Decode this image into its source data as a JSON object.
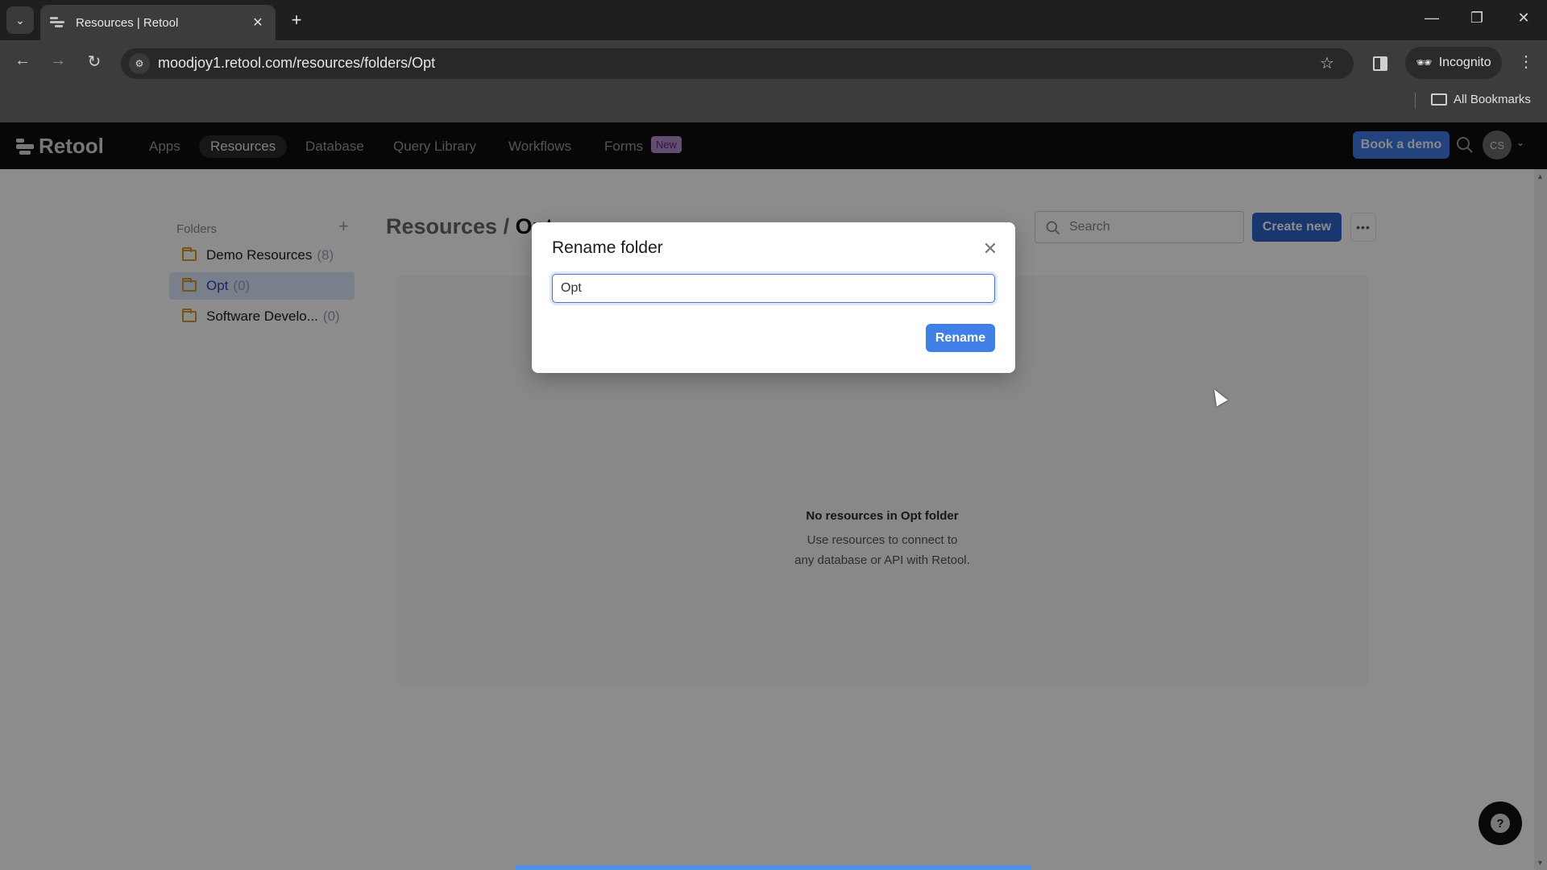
{
  "browser": {
    "tab_title": "Resources | Retool",
    "url": "moodjoy1.retool.com/resources/folders/Opt",
    "profile_label": "Incognito",
    "bookmarks_label": "All Bookmarks"
  },
  "nav": {
    "brand": "Retool",
    "links": [
      {
        "label": "Apps",
        "active": false
      },
      {
        "label": "Resources",
        "active": true
      },
      {
        "label": "Database",
        "active": false
      },
      {
        "label": "Query Library",
        "active": false
      },
      {
        "label": "Workflows",
        "active": false
      },
      {
        "label": "Forms",
        "active": false
      }
    ],
    "forms_badge": "New",
    "book_demo_label": "Book a demo",
    "avatar_initials": "CS"
  },
  "sidebar": {
    "title": "Folders",
    "folders": [
      {
        "name": "Demo Resources",
        "count": "(8)",
        "active": false
      },
      {
        "name": "Opt",
        "count": "(0)",
        "active": true
      },
      {
        "name": "Software Develo...",
        "count": "(0)",
        "active": false
      }
    ]
  },
  "main": {
    "breadcrumb_root": "Resources",
    "breadcrumb_sep": " / ",
    "breadcrumb_current": "Opt",
    "search_placeholder": "Search",
    "create_new_label": "Create new",
    "more_label": "•••",
    "empty_title": "No resources in Opt folder",
    "empty_desc_line1": "Use resources to connect to",
    "empty_desc_line2": "any database or API with Retool."
  },
  "modal": {
    "title": "Rename folder",
    "input_value": "Opt",
    "submit_label": "Rename"
  },
  "colors": {
    "primary": "#3f7fe6",
    "create_new": "#2e63c9",
    "forms_badge": "#b58ccc",
    "folder_icon": "#d39a2a"
  }
}
